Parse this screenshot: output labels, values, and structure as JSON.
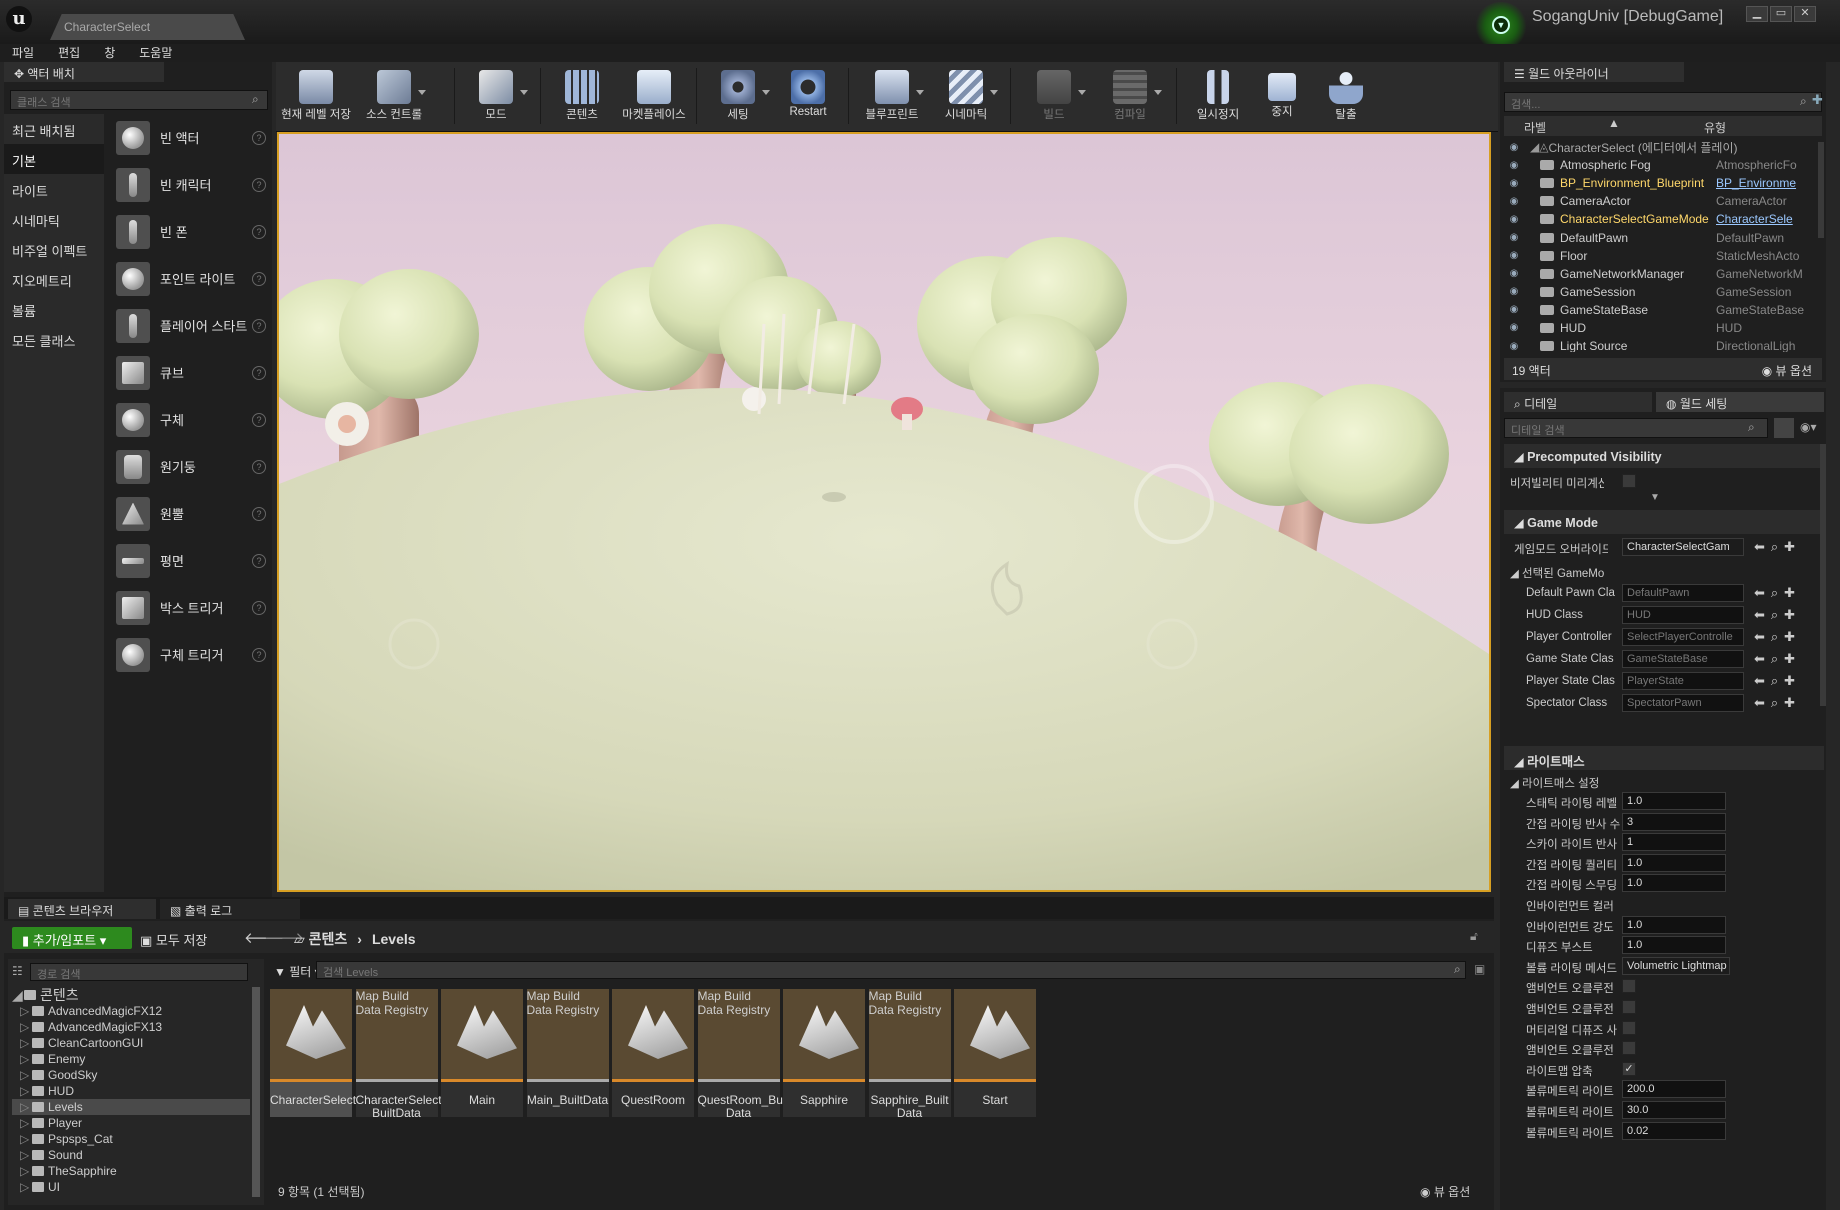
{
  "window": {
    "tab_title": "CharacterSelect",
    "project": "SogangUniv [DebugGame]",
    "min": "▁",
    "max": "▭",
    "close": "✕"
  },
  "menu": [
    "파일",
    "편집",
    "창",
    "도움말"
  ],
  "place": {
    "tab": "액터 배치",
    "search_placeholder": "클래스 검색",
    "categories": [
      "최근 배치됨",
      "기본",
      "라이트",
      "시네마틱",
      "비주얼 이펙트",
      "지오메트리",
      "볼륨",
      "모든 클래스"
    ],
    "items": [
      "빈 액터",
      "빈 캐릭터",
      "빈 폰",
      "포인트 라이트",
      "플레이어 스타트",
      "큐브",
      "구체",
      "원기둥",
      "원뿔",
      "평면",
      "박스 트리거",
      "구체 트리거"
    ]
  },
  "toolbar": [
    "현재 레벨 저장",
    "소스 컨트롤",
    "모드",
    "콘텐츠",
    "마켓플레이스",
    "세팅",
    "Restart",
    "블루프린트",
    "시네마틱",
    "빌드",
    "컴파일",
    "일시정지",
    "중지",
    "탈출"
  ],
  "outliner": {
    "tab": "월드 아웃라이너",
    "search_placeholder": "검색...",
    "col_label": "라벨",
    "col_type": "유형",
    "root": "CharacterSelect (에디터에서 플레이)",
    "rows": [
      {
        "label": "Atmospheric Fog",
        "type": "AtmosphericFo",
        "link": false
      },
      {
        "label": "BP_Environment_Blueprint",
        "type": "BP_Environme",
        "link": true
      },
      {
        "label": "CameraActor",
        "type": "CameraActor",
        "link": false
      },
      {
        "label": "CharacterSelectGameMode",
        "type": "CharacterSele",
        "link": true
      },
      {
        "label": "DefaultPawn",
        "type": "DefaultPawn",
        "link": false
      },
      {
        "label": "Floor",
        "type": "StaticMeshActo",
        "link": false
      },
      {
        "label": "GameNetworkManager",
        "type": "GameNetworkM",
        "link": false
      },
      {
        "label": "GameSession",
        "type": "GameSession",
        "link": false
      },
      {
        "label": "GameStateBase",
        "type": "GameStateBase",
        "link": false
      },
      {
        "label": "HUD",
        "type": "HUD",
        "link": false
      },
      {
        "label": "Light Source",
        "type": "DirectionalLigh",
        "link": false
      }
    ],
    "count": "19 액터",
    "view_options": "뷰 옵션"
  },
  "details": {
    "tab_details": "디테일",
    "tab_world": "월드 세팅",
    "search_placeholder": "디테일 검색",
    "sec_precomputed": "Precomputed Visibility",
    "vis_precompute": "비저빌리티 미리계산",
    "sec_gamemode": "Game Mode",
    "gamemode_override": "게임모드 오버라이드",
    "gamemode_override_val": "CharacterSelectGam",
    "selected_gamemode": "선택된 GameMode",
    "gm_rows": [
      {
        "label": "Default Pawn Cla",
        "value": "DefaultPawn"
      },
      {
        "label": "HUD Class",
        "value": "HUD"
      },
      {
        "label": "Player Controller",
        "value": "SelectPlayerControlle"
      },
      {
        "label": "Game State Clas",
        "value": "GameStateBase"
      },
      {
        "label": "Player State Clas",
        "value": "PlayerState"
      },
      {
        "label": "Spectator Class",
        "value": "SpectatorPawn"
      }
    ],
    "sec_lightmass": "라이트매스",
    "lightmass_settings": "라이트매스 설정",
    "lm_rows": [
      {
        "label": "스태틱 라이팅 레벨",
        "value": "1.0",
        "kind": "num"
      },
      {
        "label": "간접 라이팅 반사 수",
        "value": "3",
        "kind": "num"
      },
      {
        "label": "스카이 라이트 반사",
        "value": "1",
        "kind": "num"
      },
      {
        "label": "간접 라이팅 퀄리티",
        "value": "1.0",
        "kind": "num"
      },
      {
        "label": "간접 라이팅 스무딩",
        "value": "1.0",
        "kind": "num"
      },
      {
        "label": "인바이런먼트 컬러",
        "value": "",
        "kind": "color"
      },
      {
        "label": "인바이런먼트 강도",
        "value": "1.0",
        "kind": "num"
      },
      {
        "label": "디퓨즈 부스트",
        "value": "1.0",
        "kind": "num"
      },
      {
        "label": "볼륨 라이팅 메서드",
        "value": "Volumetric Lightmap",
        "kind": "combo"
      },
      {
        "label": "앰비언트 오클루전",
        "value": "",
        "kind": "chk"
      },
      {
        "label": "앰비언트 오클루전",
        "value": "",
        "kind": "chk"
      },
      {
        "label": "머티리얼 디퓨즈 사",
        "value": "",
        "kind": "chk"
      },
      {
        "label": "앰비언트 오클루전",
        "value": "",
        "kind": "chk"
      },
      {
        "label": "라이트맵 압축",
        "value": "✓",
        "kind": "chk"
      },
      {
        "label": "볼류메트릭 라이트",
        "value": "200.0",
        "kind": "num"
      },
      {
        "label": "볼류메트릭 라이트",
        "value": "30.0",
        "kind": "num"
      },
      {
        "label": "볼류메트릭 라이트",
        "value": "0.02",
        "kind": "num"
      }
    ]
  },
  "content_browser": {
    "tab": "콘텐츠 브라우저",
    "tab_log": "출력 로그",
    "add_import": "추가/임포트",
    "save_all": "모두 저장",
    "crumb_root": "콘텐츠",
    "crumb_leaf": "Levels",
    "path_search_placeholder": "경로 검색",
    "filter": "필터",
    "asset_search_placeholder": "검색 Levels",
    "tree_root": "콘텐츠",
    "tree": [
      "AdvancedMagicFX12",
      "AdvancedMagicFX13",
      "CleanCartoonGUI",
      "Enemy",
      "GoodSky",
      "HUD",
      "Levels",
      "Player",
      "Pspsps_Cat",
      "Sound",
      "TheSapphire",
      "UI"
    ],
    "registry_label": "Map Build Data Registry",
    "assets": [
      {
        "name": "CharacterSelect",
        "kind": "map"
      },
      {
        "name": "CharacterSelect_ BuiltData",
        "kind": "reg"
      },
      {
        "name": "Main",
        "kind": "map"
      },
      {
        "name": "Main_BuiltData",
        "kind": "reg"
      },
      {
        "name": "QuestRoom",
        "kind": "map"
      },
      {
        "name": "QuestRoom_Built Data",
        "kind": "reg"
      },
      {
        "name": "Sapphire",
        "kind": "map"
      },
      {
        "name": "Sapphire_Built Data",
        "kind": "reg"
      },
      {
        "name": "Start",
        "kind": "map"
      }
    ],
    "status": "9 항목 (1 선택됨)",
    "view_options": "뷰 옵션"
  }
}
